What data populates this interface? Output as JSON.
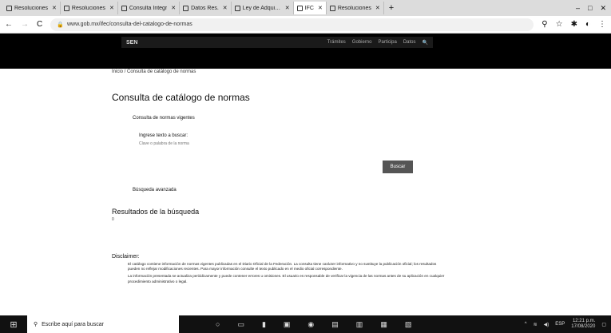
{
  "browser": {
    "tabs": [
      {
        "label": "Resoluciones"
      },
      {
        "label": "Resoluciones"
      },
      {
        "label": "Consulta Integr"
      },
      {
        "label": "Datos Res."
      },
      {
        "label": "Ley de Adquisic"
      },
      {
        "label": "IFC"
      },
      {
        "label": "Resoluciones"
      }
    ],
    "new_tab_symbol": "+",
    "url": "www.gob.mx/ifec/consulta-del-catalogo-de-normas",
    "controls": {
      "minimize": "–",
      "maximize": "□",
      "close": "✕"
    }
  },
  "site": {
    "logo": "SEN",
    "nav": [
      "Trámites",
      "Gobierno",
      "Participa",
      "Datos",
      "🔍"
    ]
  },
  "breadcrumb": "Inicio / Consulta de catálogo de normas",
  "page_title": "Consulta de catálogo de normas",
  "subheading": "Consulta de normas vigentes",
  "search": {
    "label": "Ingrese texto a buscar:",
    "placeholder": "Clave o palabra de la norma",
    "button": "Buscar"
  },
  "advanced_link": "Búsqueda avanzada",
  "results": {
    "title": "Resultados de la búsqueda",
    "count": "0"
  },
  "disclaimer": {
    "title": "Disclaimer:",
    "paragraphs": [
      "El catálogo contiene información de normas vigentes publicadas en el Diario Oficial de la Federación. La consulta tiene carácter informativo y no sustituye la publicación oficial; los resultados pueden no reflejar modificaciones recientes. Para mayor información consulte el texto publicado en el medio oficial correspondiente.",
      "La información presentada se actualiza periódicamente y puede contener errores u omisiones. El usuario es responsable de verificar la vigencia de las normas antes de su aplicación en cualquier procedimiento administrativo o legal."
    ]
  },
  "taskbar": {
    "search_placeholder": "Escribe aquí para buscar",
    "time": "12:21 p.m.",
    "date": "17/08/2020",
    "lang": "ESP"
  }
}
